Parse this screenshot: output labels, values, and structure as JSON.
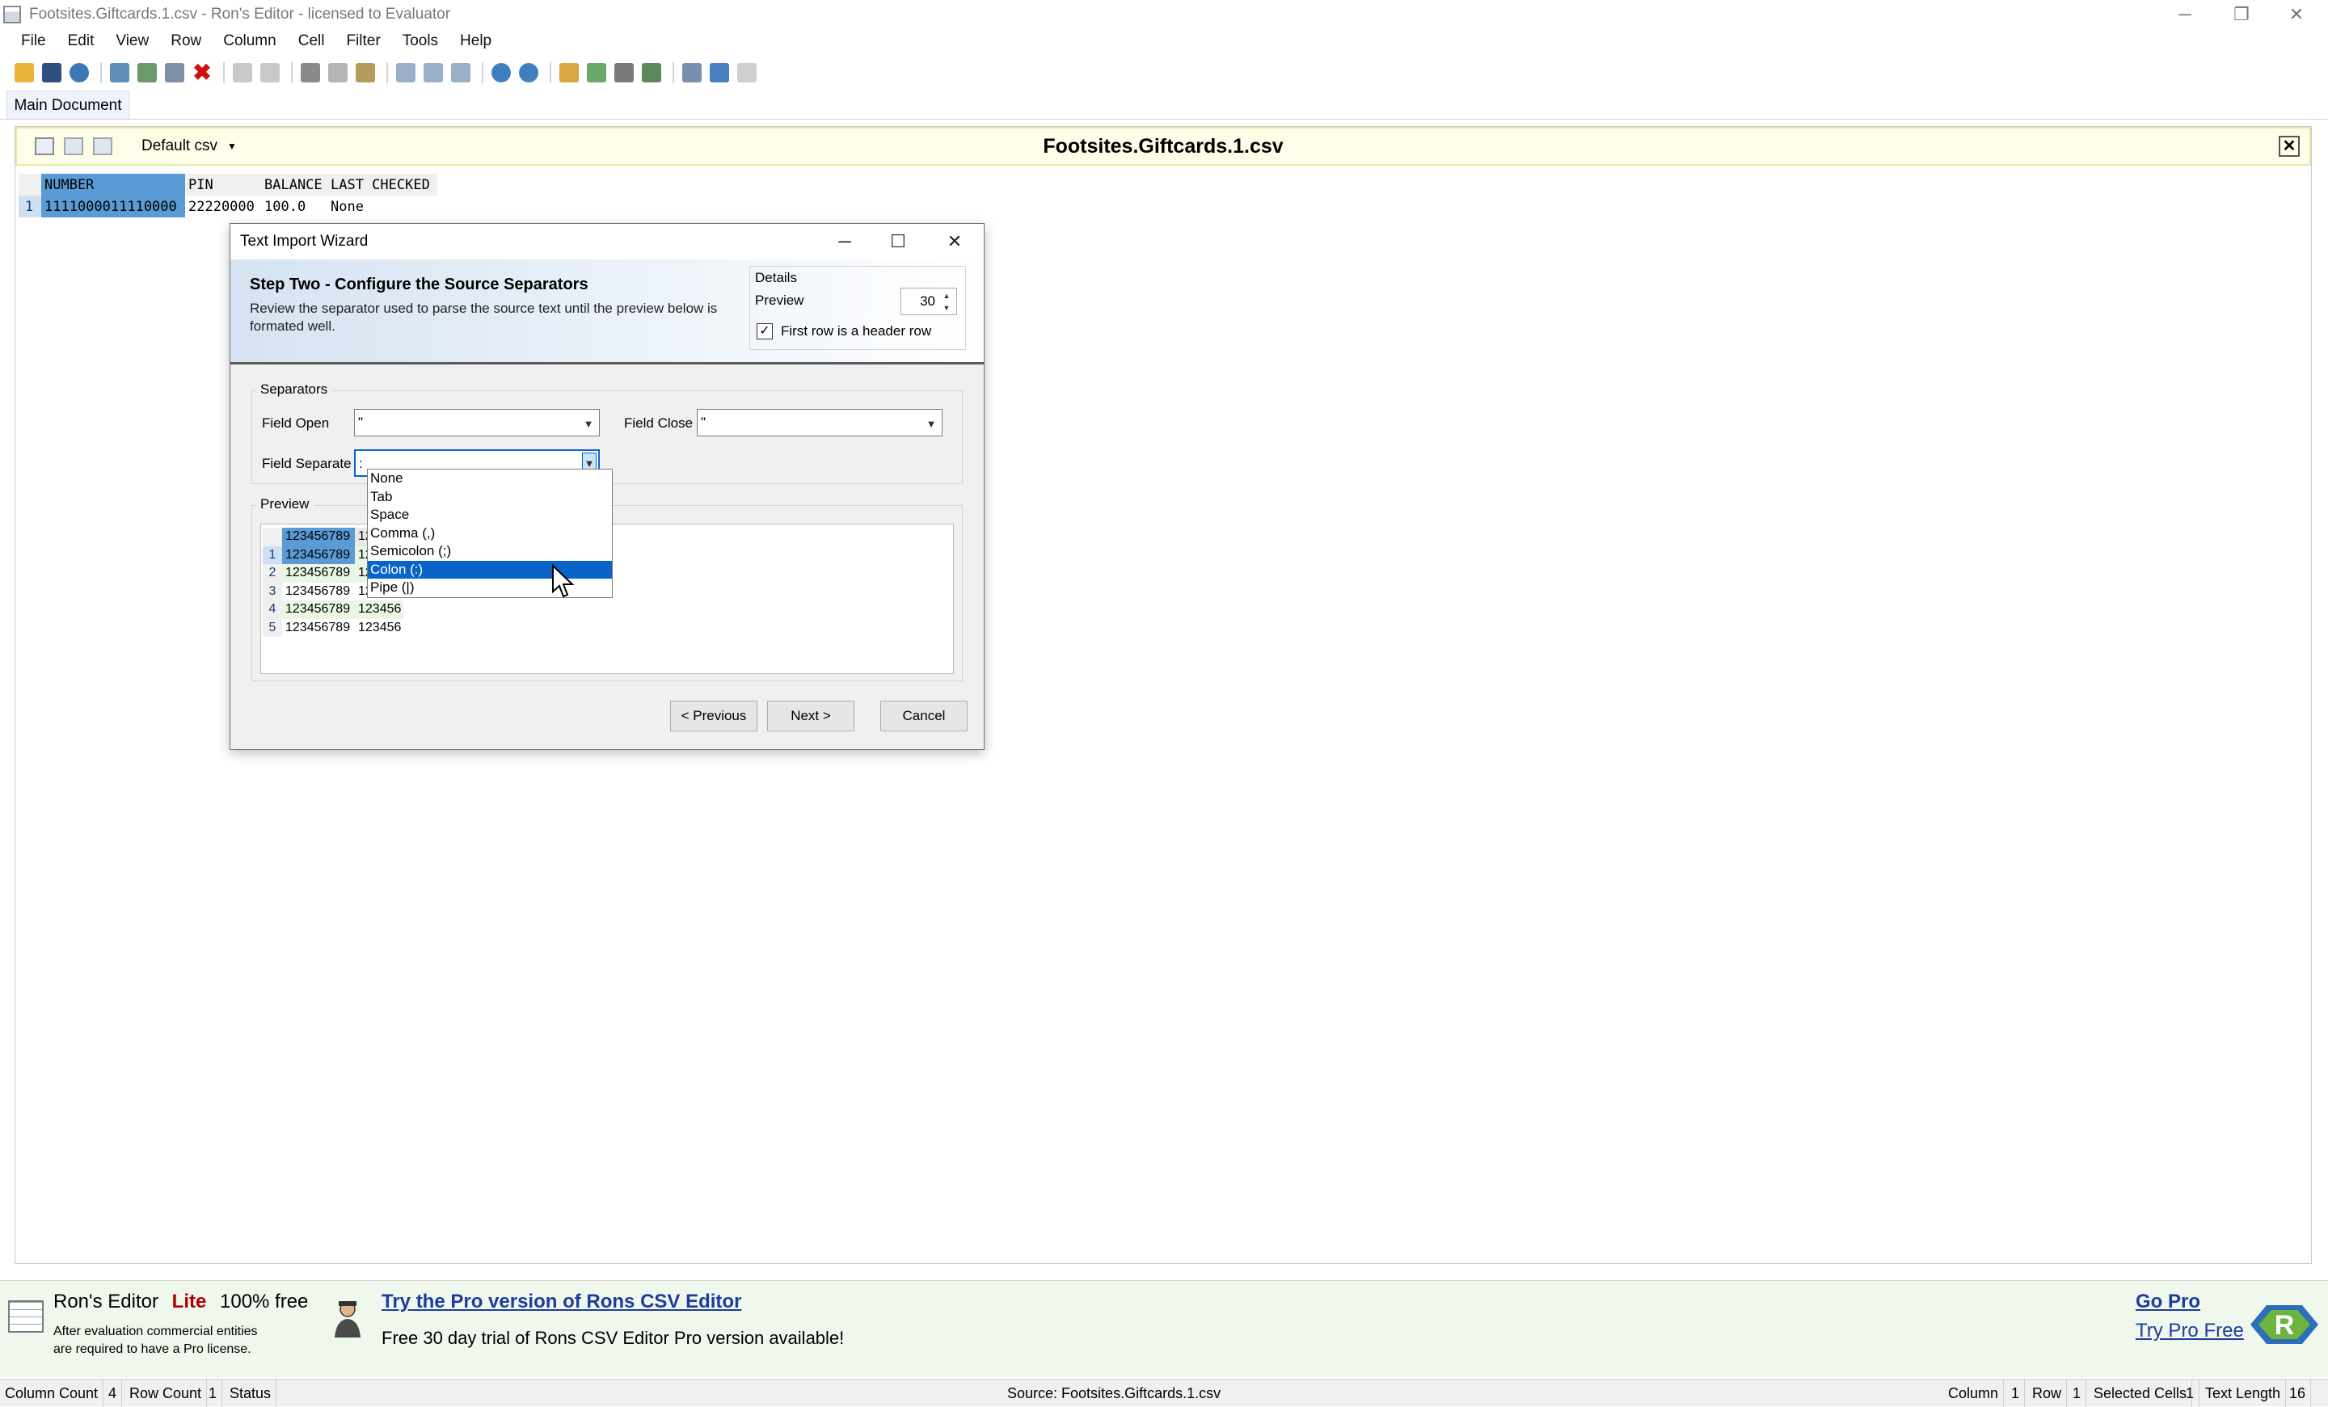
{
  "window": {
    "title": "Footsites.Giftcards.1.csv - Ron's Editor - licensed to Evaluator",
    "min_glyph": "─",
    "restore_glyph": "❐",
    "close_glyph": "✕"
  },
  "menu": [
    "File",
    "Edit",
    "View",
    "Row",
    "Column",
    "Cell",
    "Filter",
    "Tools",
    "Help"
  ],
  "tab": {
    "label": "Main Document"
  },
  "document": {
    "preset": "Default csv",
    "filename": "Footsites.Giftcards.1.csv",
    "close_glyph": "✕"
  },
  "grid": {
    "headers": [
      "NUMBER",
      "PIN",
      "BALANCE",
      "LAST CHECKED"
    ],
    "rows": [
      {
        "num": "1",
        "cells": [
          "1111000011110000",
          "22220000",
          "100.0",
          "None"
        ]
      }
    ]
  },
  "dialog": {
    "title": "Text Import Wizard",
    "step_title": "Step Two - Configure the Source Separators",
    "step_desc": "Review the separator used to parse the source text until the preview below is formated well.",
    "details": {
      "legend": "Details",
      "preview_label": "Preview",
      "preview_value": "30",
      "header_checked": true,
      "header_label": "First row is a header row",
      "check_glyph": "✓"
    },
    "separators": {
      "legend": "Separators",
      "field_open_label": "Field Open",
      "field_open_value": "\"",
      "field_close_label": "Field Close",
      "field_close_value": "\"",
      "field_separate_label": "Field Separate",
      "field_separate_value": ":",
      "options": [
        "None",
        "Tab",
        "Space",
        "Comma (,)",
        "Semicolon (;)",
        "Colon (:)",
        "Pipe (|)"
      ],
      "selected_option": "Colon (:)"
    },
    "preview": {
      "legend": "Preview",
      "header": [
        "123456789",
        "12"
      ],
      "rows": [
        {
          "num": "1",
          "cells": [
            "123456789",
            "12"
          ]
        },
        {
          "num": "2",
          "cells": [
            "123456789",
            "12"
          ]
        },
        {
          "num": "3",
          "cells": [
            "123456789",
            "12"
          ]
        },
        {
          "num": "4",
          "cells": [
            "123456789",
            "123456"
          ]
        },
        {
          "num": "5",
          "cells": [
            "123456789",
            "123456"
          ]
        }
      ]
    },
    "buttons": {
      "previous": "< Previous",
      "next": "Next >",
      "cancel": "Cancel"
    }
  },
  "promo": {
    "brand": "Ron's Editor",
    "lite": "Lite",
    "free": "100% free",
    "sub_line1": "After evaluation commercial entities",
    "sub_line2": "are required to have a Pro license.",
    "link": "Try the Pro version of Rons CSV Editor",
    "message": "Free 30 day trial of Rons CSV Editor Pro version available!",
    "go_pro": "Go Pro",
    "try_pro": "Try Pro Free"
  },
  "status": {
    "column_count_label": "Column Count",
    "column_count": "4",
    "row_count_label": "Row Count",
    "row_count": "1",
    "status_label": "Status",
    "source": "Source: Footsites.Giftcards.1.csv",
    "column_label": "Column",
    "column": "1",
    "row_label": "Row",
    "row": "1",
    "selected_cells_label": "Selected Cells",
    "selected_cells": "1",
    "text_length_label": "Text Length",
    "text_length": "16"
  }
}
